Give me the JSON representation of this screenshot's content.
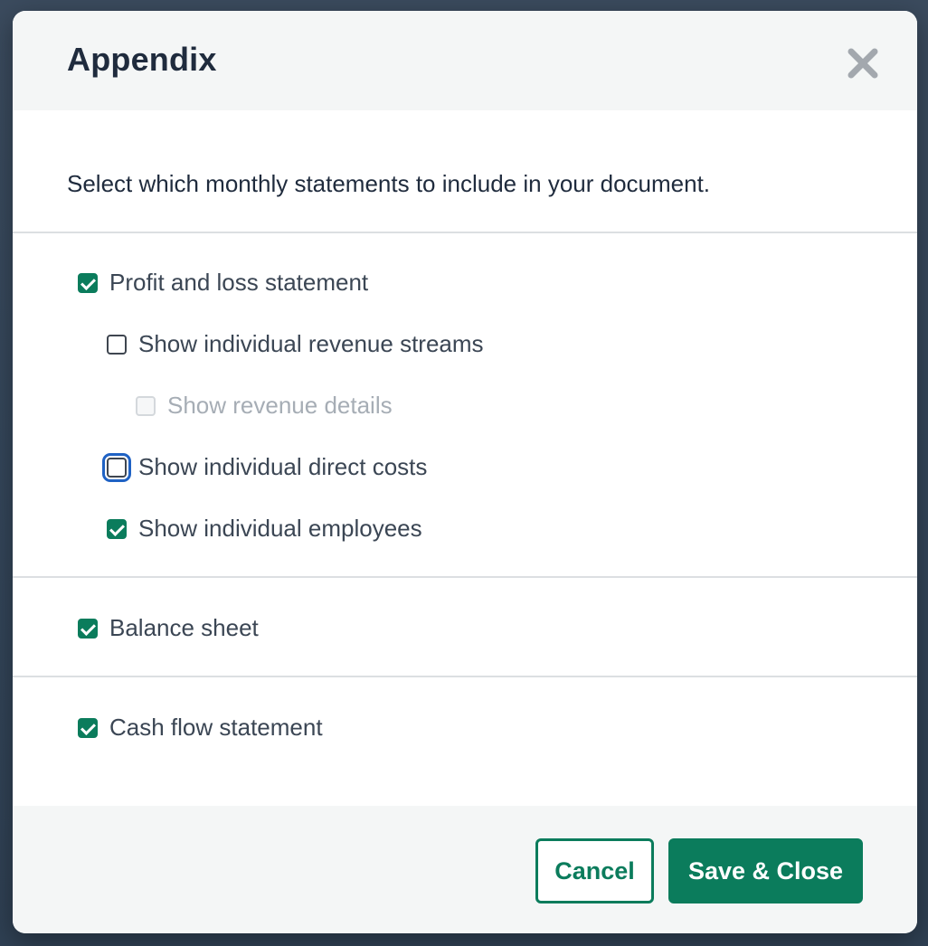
{
  "dialog": {
    "title": "Appendix",
    "close_icon": "close-icon",
    "intro": "Select which monthly statements to include in your document."
  },
  "options": {
    "profit_loss": {
      "label": "Profit and loss statement",
      "checked": true
    },
    "revenue_streams": {
      "label": "Show individual revenue streams",
      "checked": false
    },
    "revenue_details": {
      "label": "Show revenue details",
      "checked": false,
      "disabled": true
    },
    "direct_costs": {
      "label": "Show individual direct costs",
      "checked": false,
      "focused": true
    },
    "employees": {
      "label": "Show individual employees",
      "checked": true
    },
    "balance_sheet": {
      "label": "Balance sheet",
      "checked": true
    },
    "cash_flow": {
      "label": "Cash flow statement",
      "checked": true
    }
  },
  "footer": {
    "cancel_label": "Cancel",
    "save_label": "Save & Close"
  },
  "colors": {
    "accent": "#0b7c5c",
    "focus_ring": "#1f62c4",
    "text_dark": "#1f2b3d",
    "text_body": "#3b4654",
    "text_disabled": "#a6adb5"
  }
}
